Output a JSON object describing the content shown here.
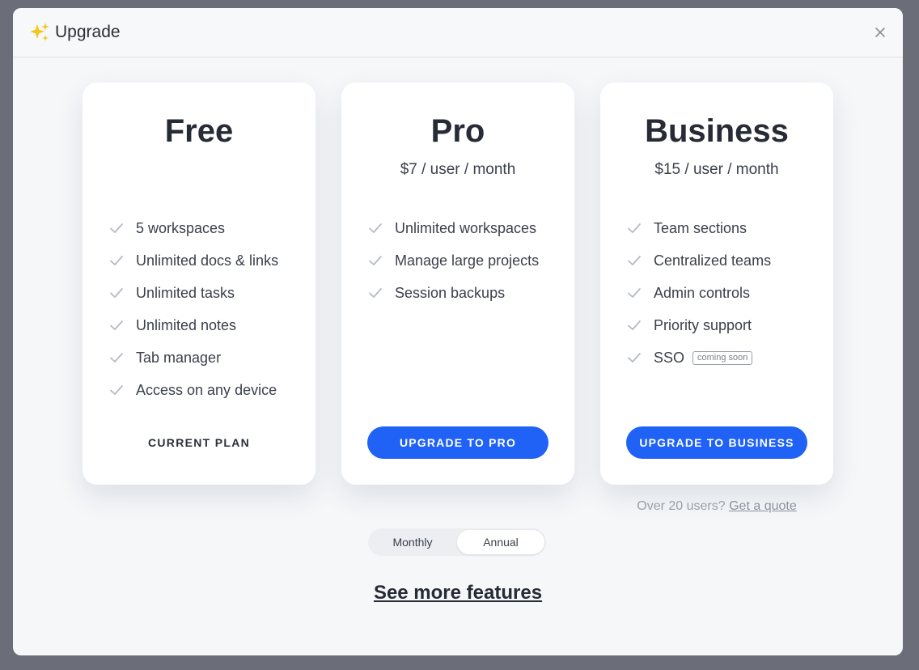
{
  "modal": {
    "title": "Upgrade",
    "title_icon": "sparkles-icon",
    "close_icon": "close-icon"
  },
  "colors": {
    "accent": "#1f62f5",
    "sparkle": "#f5c518",
    "check": "#b5bac2"
  },
  "plans": [
    {
      "name": "Free",
      "price": "",
      "features": [
        {
          "label": "5 workspaces"
        },
        {
          "label": "Unlimited docs & links"
        },
        {
          "label": "Unlimited tasks"
        },
        {
          "label": "Unlimited notes"
        },
        {
          "label": "Tab manager"
        },
        {
          "label": "Access on any device"
        }
      ],
      "action_label": "CURRENT PLAN"
    },
    {
      "name": "Pro",
      "price": "$7 / user / month",
      "features": [
        {
          "label": "Unlimited workspaces"
        },
        {
          "label": "Manage large projects"
        },
        {
          "label": "Session backups"
        }
      ],
      "action_label": "UPGRADE TO PRO"
    },
    {
      "name": "Business",
      "price": "$15 / user / month",
      "features": [
        {
          "label": "Team sections"
        },
        {
          "label": "Centralized teams"
        },
        {
          "label": "Admin controls"
        },
        {
          "label": "Priority support"
        },
        {
          "label": "SSO",
          "badge": "coming soon"
        }
      ],
      "action_label": "UPGRADE TO BUSINESS"
    }
  ],
  "quote": {
    "text": "Over 20 users?",
    "link_label": "Get a quote"
  },
  "billing_toggle": {
    "options": [
      "Monthly",
      "Annual"
    ],
    "selected": "Annual"
  },
  "see_more_label": "See more features"
}
